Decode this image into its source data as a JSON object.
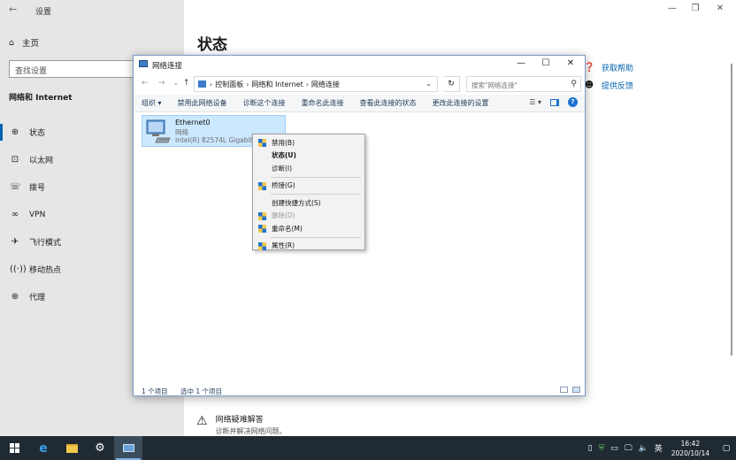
{
  "settings": {
    "title": "设置",
    "home_label": "主页",
    "search_placeholder": "查找设置",
    "section_title": "网络和 Internet",
    "nav": [
      {
        "label": "状态",
        "icon": "globe-icon"
      },
      {
        "label": "以太网",
        "icon": "ethernet-icon"
      },
      {
        "label": "拨号",
        "icon": "dialup-icon"
      },
      {
        "label": "VPN",
        "icon": "vpn-icon"
      },
      {
        "label": "飞行模式",
        "icon": "airplane-icon"
      },
      {
        "label": "移动热点",
        "icon": "hotspot-icon"
      },
      {
        "label": "代理",
        "icon": "globe-icon"
      }
    ],
    "page_heading": "状态",
    "help": {
      "get_help": "获取帮助",
      "feedback": "提供反馈"
    },
    "troubleshoot": {
      "title": "网络疑难解答",
      "subtitle": "诊断并解决网络问题。"
    }
  },
  "explorer": {
    "title": "网络连接",
    "path": [
      "控制面板",
      "网络和 Internet",
      "网络连接"
    ],
    "search_placeholder": "搜索\"网络连接\"",
    "toolbar": [
      "组织 ▾",
      "禁用此网络设备",
      "诊断这个连接",
      "重命名此连接",
      "查看此连接的状态",
      "更改此连接的设置"
    ],
    "item": {
      "name": "Ethernet0",
      "network": "网络",
      "device": "Intel(R) 82574L Gigabit Network Connection"
    },
    "status": {
      "count": "1 个项目",
      "selected": "选中 1 个项目"
    }
  },
  "context_menu": [
    {
      "label": "禁用(B)",
      "shield": true,
      "bold": false,
      "disabled": false
    },
    {
      "label": "状态(U)",
      "shield": false,
      "bold": true,
      "disabled": false
    },
    {
      "label": "诊断(I)",
      "shield": false,
      "bold": false,
      "disabled": false
    },
    {
      "separator": true
    },
    {
      "label": "桥接(G)",
      "shield": true,
      "bold": false,
      "disabled": false
    },
    {
      "separator": true
    },
    {
      "label": "创建快捷方式(S)",
      "shield": false,
      "bold": false,
      "disabled": false
    },
    {
      "label": "删除(D)",
      "shield": true,
      "bold": false,
      "disabled": true
    },
    {
      "label": "重命名(M)",
      "shield": true,
      "bold": false,
      "disabled": false
    },
    {
      "separator": true
    },
    {
      "label": "属性(R)",
      "shield": true,
      "bold": false,
      "disabled": false
    }
  ],
  "taskbar": {
    "time": "16:42",
    "date": "2020/10/14",
    "ime": "英",
    "accent": "#7fb2e5"
  }
}
